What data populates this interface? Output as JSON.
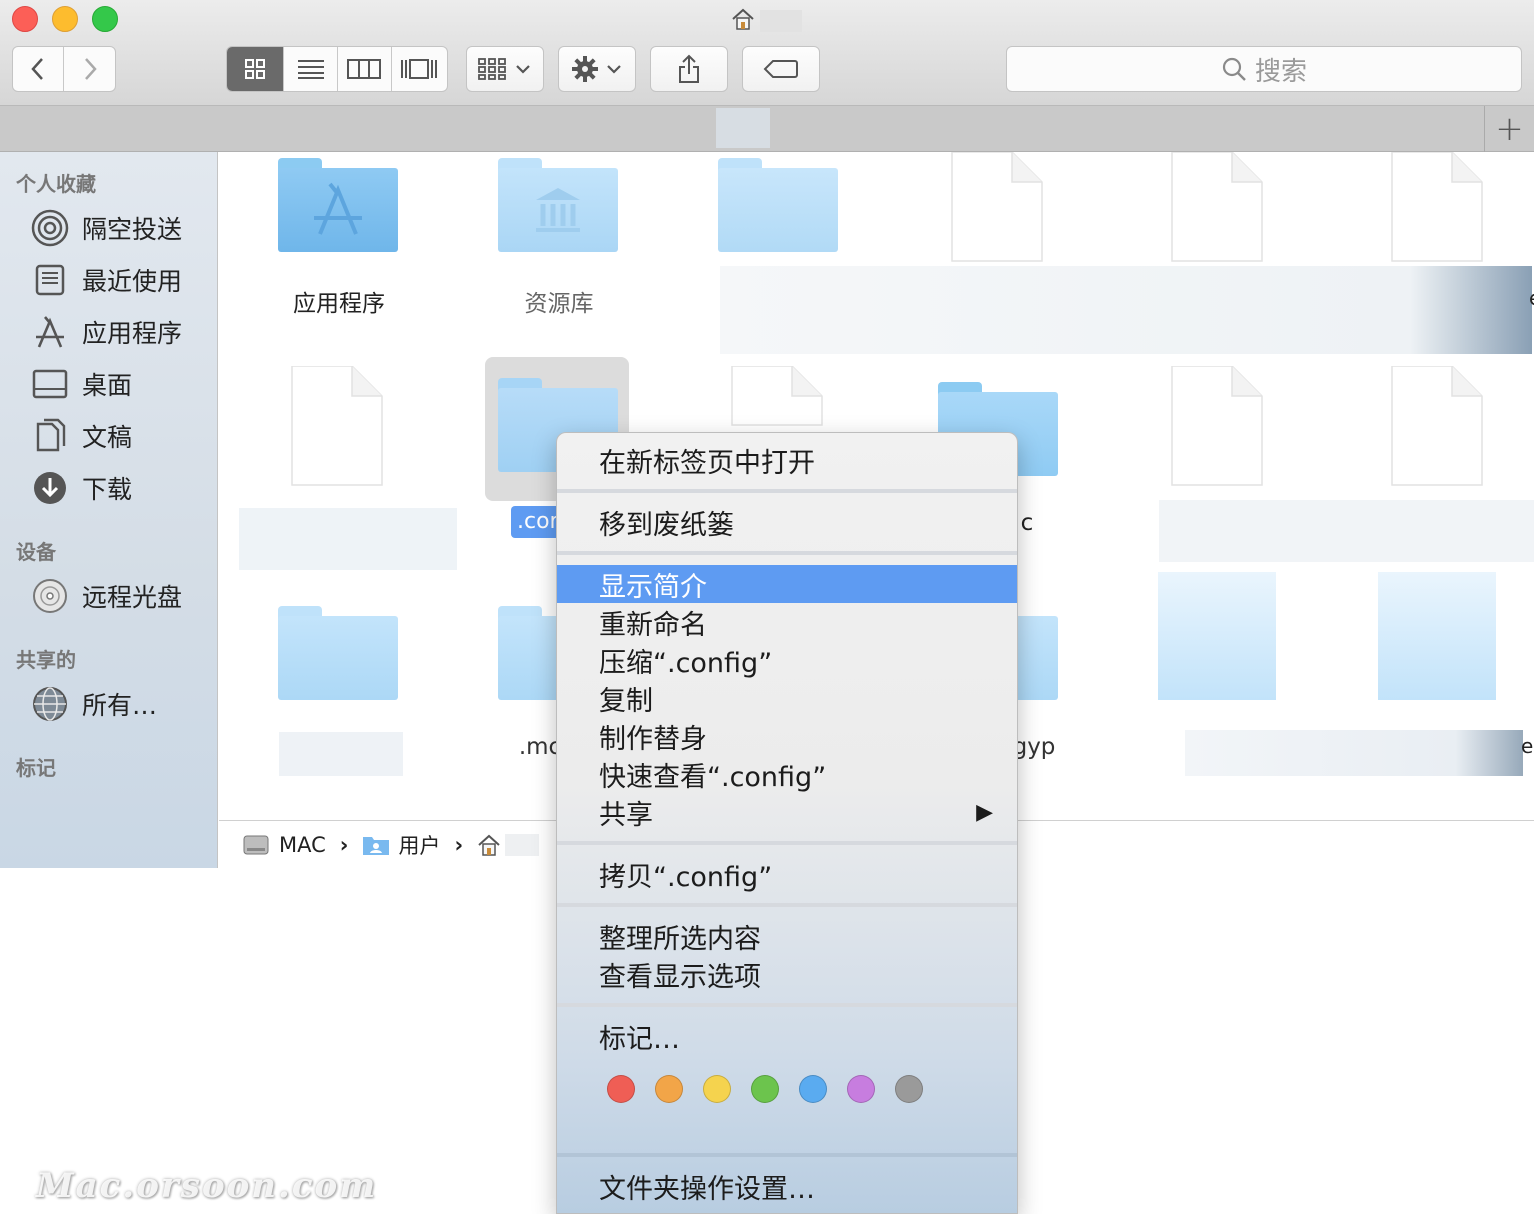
{
  "search": {
    "placeholder": "搜索"
  },
  "sidebar": {
    "favorites_header": "个人收藏",
    "favorites": [
      {
        "label": "隔空投送",
        "icon": "airdrop-icon"
      },
      {
        "label": "最近使用",
        "icon": "recents-icon"
      },
      {
        "label": "应用程序",
        "icon": "applications-icon"
      },
      {
        "label": "桌面",
        "icon": "desktop-icon"
      },
      {
        "label": "文稿",
        "icon": "documents-icon"
      },
      {
        "label": "下载",
        "icon": "downloads-icon"
      }
    ],
    "devices_header": "设备",
    "devices": [
      {
        "label": "远程光盘",
        "icon": "disc-icon"
      }
    ],
    "shared_header": "共享的",
    "shared": [
      {
        "label": "所有…",
        "icon": "network-icon"
      }
    ],
    "tags_header": "标记"
  },
  "files": {
    "applications": "应用程序",
    "library": "资源库",
    "selected_partial": ".con",
    "row2_partial": "c",
    "row3_partial_a": ".mc",
    "row3_partial_b": "gyp",
    "row1_edge": "e",
    "row3_edge": "e"
  },
  "path": {
    "root": "MAC",
    "users": "用户"
  },
  "menu": {
    "open_new_tab": "在新标签页中打开",
    "move_trash": "移到废纸篓",
    "get_info": "显示简介",
    "rename": "重新命名",
    "compress": "压缩“.config”",
    "duplicate": "复制",
    "make_alias": "制作替身",
    "quick_look": "快速查看“.config”",
    "share": "共享",
    "copy": "拷贝“.config”",
    "clean_up": "整理所选内容",
    "view_options": "查看显示选项",
    "tags": "标记…",
    "folder_actions": "文件夹操作设置…",
    "tag_colors": [
      "#ef5e55",
      "#f2a548",
      "#f5d34e",
      "#6cc44d",
      "#5aabf0",
      "#c77ddf",
      "#9a9a9a"
    ]
  },
  "watermark": "Mac.orsoon.com"
}
